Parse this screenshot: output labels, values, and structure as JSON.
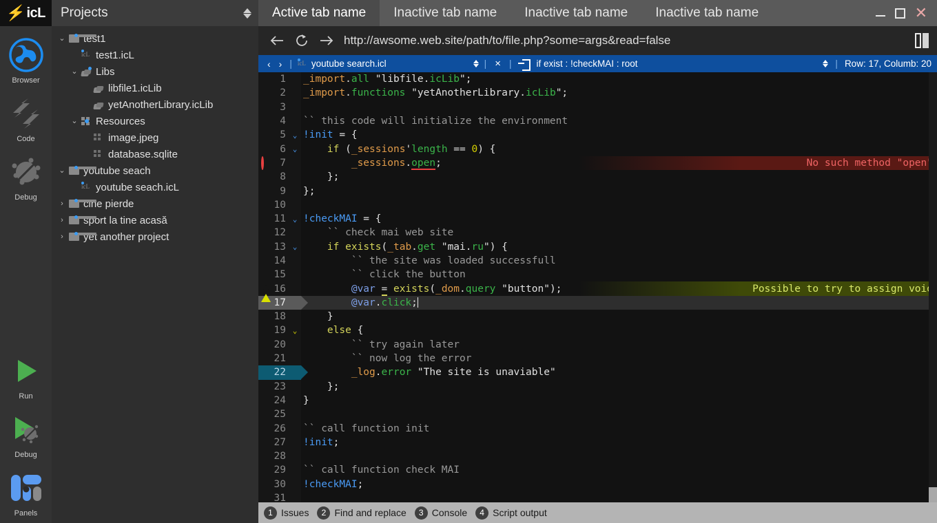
{
  "app": {
    "logo_bolt": "⚡",
    "logo_text": "icL"
  },
  "activity_bar": {
    "items": [
      {
        "label": "Browser",
        "icon": "globe-icon"
      },
      {
        "label": "Code",
        "icon": "code-bolt-icon"
      },
      {
        "label": "Debug",
        "icon": "bug-icon"
      }
    ],
    "bottom_items": [
      {
        "label": "Run",
        "icon": "play-icon"
      },
      {
        "label": "Debug",
        "icon": "play-bug-icon"
      },
      {
        "label": "Panels",
        "icon": "panels-icon"
      }
    ]
  },
  "projects": {
    "title": "Projects",
    "tree": [
      {
        "label": "test1",
        "depth": 0,
        "chev": "v",
        "icon": "folder"
      },
      {
        "label": "test1.icL",
        "depth": 1,
        "chev": "",
        "icon": "icl"
      },
      {
        "label": "Libs",
        "depth": 1,
        "chev": "v",
        "icon": "lib"
      },
      {
        "label": "libfile1.icLib",
        "depth": 2,
        "chev": "",
        "icon": "libplain"
      },
      {
        "label": "yetAnotherLibrary.icLib",
        "depth": 2,
        "chev": "",
        "icon": "libplain"
      },
      {
        "label": "Resources",
        "depth": 1,
        "chev": "v",
        "icon": "res"
      },
      {
        "label": "image.jpeg",
        "depth": 2,
        "chev": "",
        "icon": "file"
      },
      {
        "label": "database.sqlite",
        "depth": 2,
        "chev": "",
        "icon": "file"
      },
      {
        "label": "youtube seach",
        "depth": 0,
        "chev": "v",
        "icon": "folder"
      },
      {
        "label": "youtube seach.icL",
        "depth": 1,
        "chev": "",
        "icon": "icl"
      },
      {
        "label": "cine pierde",
        "depth": 0,
        "chev": ">",
        "icon": "folder"
      },
      {
        "label": "sport la tine acasă",
        "depth": 0,
        "chev": ">",
        "icon": "folder"
      },
      {
        "label": "yet another project",
        "depth": 0,
        "chev": ">",
        "icon": "folder"
      }
    ]
  },
  "tabs": [
    {
      "label": "Active tab name",
      "active": true
    },
    {
      "label": "Inactive tab name",
      "active": false
    },
    {
      "label": "Inactive tab name",
      "active": false
    },
    {
      "label": "Inactive tab name",
      "active": false
    }
  ],
  "window_controls": {
    "minimize": "minimize-icon",
    "maximize": "maximize-icon",
    "close": "close-icon"
  },
  "urlbar": {
    "back": "back-arrow-icon",
    "reload": "reload-icon",
    "forward": "forward-arrow-icon",
    "url": "http://awsome.web.site/path/to/file.php?some=args&read=false",
    "panes": "split-panes-icon"
  },
  "breadcrumb": {
    "prev": "‹",
    "next": "›",
    "file": "youtube search.icl",
    "close": "×",
    "scope": "if exist : !checkMAI : root",
    "position": "Row: 17, Columb: 20"
  },
  "editor": {
    "lines": [
      {
        "n": 1,
        "fold": "",
        "marker": "",
        "state": ""
      },
      {
        "n": 2,
        "fold": "",
        "marker": "",
        "state": ""
      },
      {
        "n": 3,
        "fold": "",
        "marker": "",
        "state": ""
      },
      {
        "n": 4,
        "fold": "",
        "marker": "",
        "state": ""
      },
      {
        "n": 5,
        "fold": "v",
        "marker": "",
        "state": ""
      },
      {
        "n": 6,
        "fold": "v",
        "marker": "",
        "state": ""
      },
      {
        "n": 7,
        "fold": "",
        "marker": "error",
        "state": "error"
      },
      {
        "n": 8,
        "fold": "",
        "marker": "",
        "state": ""
      },
      {
        "n": 9,
        "fold": "",
        "marker": "",
        "state": ""
      },
      {
        "n": 10,
        "fold": "",
        "marker": "",
        "state": ""
      },
      {
        "n": 11,
        "fold": "v",
        "marker": "",
        "state": ""
      },
      {
        "n": 12,
        "fold": "",
        "marker": "",
        "state": ""
      },
      {
        "n": 13,
        "fold": "v",
        "marker": "",
        "state": ""
      },
      {
        "n": 14,
        "fold": "",
        "marker": "",
        "state": ""
      },
      {
        "n": 15,
        "fold": "",
        "marker": "",
        "state": ""
      },
      {
        "n": 16,
        "fold": "",
        "marker": "warning",
        "state": "warning"
      },
      {
        "n": 17,
        "fold": "",
        "marker": "",
        "state": "current"
      },
      {
        "n": 18,
        "fold": "",
        "marker": "",
        "state": ""
      },
      {
        "n": 19,
        "fold": "v",
        "marker": "",
        "state": ""
      },
      {
        "n": 20,
        "fold": "",
        "marker": "",
        "state": ""
      },
      {
        "n": 21,
        "fold": "",
        "marker": "",
        "state": ""
      },
      {
        "n": 22,
        "fold": "",
        "marker": "",
        "state": "breakpoint"
      },
      {
        "n": 23,
        "fold": "",
        "marker": "",
        "state": ""
      },
      {
        "n": 24,
        "fold": "",
        "marker": "",
        "state": ""
      },
      {
        "n": 25,
        "fold": "",
        "marker": "",
        "state": ""
      },
      {
        "n": 26,
        "fold": "",
        "marker": "",
        "state": ""
      },
      {
        "n": 27,
        "fold": "",
        "marker": "",
        "state": ""
      },
      {
        "n": 28,
        "fold": "",
        "marker": "",
        "state": ""
      },
      {
        "n": 29,
        "fold": "",
        "marker": "",
        "state": ""
      },
      {
        "n": 30,
        "fold": "",
        "marker": "",
        "state": ""
      },
      {
        "n": 31,
        "fold": "",
        "marker": "",
        "state": ""
      }
    ],
    "code_plain": [
      "_import.all \"libfile.icLib\";",
      "_import.functions \"yetAnotherLibrary.icLib\";",
      "",
      "`` this code will initialize the environment",
      "!init = {",
      "    if (_sessions'length == 0) {",
      "        _sessions.open;",
      "    };",
      "};",
      "",
      "!checkMAI = {",
      "    `` check mai web site",
      "    if exists(_tab.get \"mai.ru\") {",
      "        `` the site was loaded successfull",
      "        `` click the button",
      "        @var = exists(_dom.query \"button\");",
      "        @var.click;",
      "    }",
      "    else {",
      "        `` try again later",
      "        `` now log the error",
      "        _log.error \"The site is unaviable\"",
      "    };",
      "}",
      "",
      "`` call function init",
      "!init;",
      "",
      "`` call function check MAI",
      "!checkMAI;",
      ""
    ],
    "messages": {
      "line7": "No such method \"open\"",
      "line16": "Possible to try to assign void"
    }
  },
  "statusbar": {
    "items": [
      {
        "num": "1",
        "label": "Issues"
      },
      {
        "num": "2",
        "label": "Find and replace"
      },
      {
        "num": "3",
        "label": "Console"
      },
      {
        "num": "4",
        "label": "Script output"
      }
    ]
  },
  "colors": {
    "accent_blue": "#0e4f9e",
    "error_red": "#e84040",
    "warning_yellow": "#d8e000",
    "breakpoint_teal": "#0d5b72",
    "run_green": "#4caf50",
    "tree_dot_blue": "#3b9bf2"
  }
}
